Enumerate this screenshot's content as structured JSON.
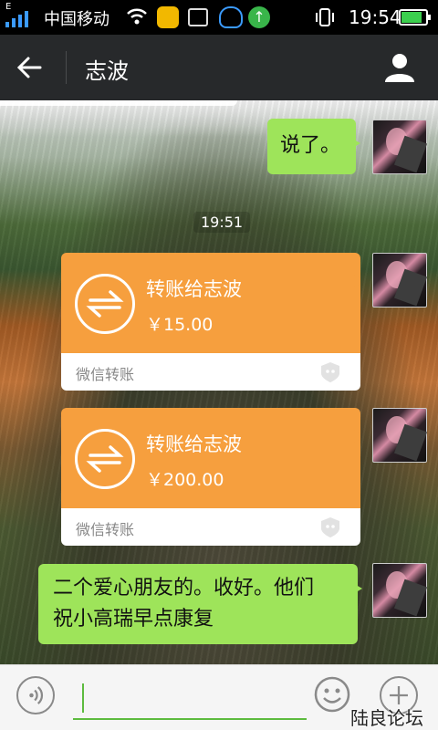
{
  "status_bar": {
    "network_type": "E",
    "carrier": "中国移动",
    "time": "19:54",
    "battery_level": 0.85,
    "notification_icons": [
      "app-icon",
      "image-icon",
      "qq-icon",
      "upload-arrow-icon"
    ],
    "battery_color": "#3ccf4e"
  },
  "header": {
    "title": "志波",
    "background": "#27292b"
  },
  "messages": [
    {
      "type": "text",
      "side": "right",
      "text": "说了。"
    },
    {
      "type": "time",
      "text": "19:51"
    },
    {
      "type": "transfer",
      "side": "right",
      "title": "转账给志波",
      "amount": "￥15.00",
      "label": "微信转账"
    },
    {
      "type": "transfer",
      "side": "right",
      "title": "转账给志波",
      "amount": "￥200.00",
      "label": "微信转账"
    },
    {
      "type": "text",
      "side": "right",
      "lines": [
        "二个爱心朋友的。收好。他们",
        "祝小高瑞早点康复"
      ]
    }
  ],
  "colors": {
    "sent_bubble": "#9ee45a",
    "transfer_orange": "#f69f3e",
    "input_underline": "#5dbb3f"
  },
  "input_bar": {
    "value": "",
    "watermark": "陆良论坛"
  }
}
